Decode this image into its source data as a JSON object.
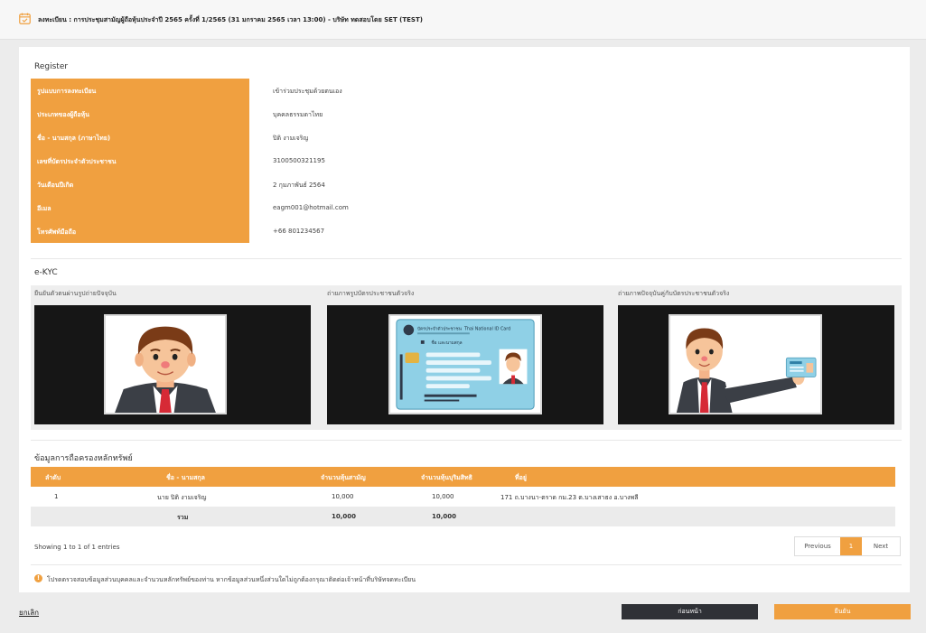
{
  "header": {
    "title": "ลงทะเบียน : การประชุมสามัญผู้ถือหุ้นประจำปี 2565 ครั้งที่ 1/2565 (31 มกราคม 2565 เวลา 13:00) - บริษัท ทดสอบโดย SET (TEST)",
    "icon": "calendar-icon"
  },
  "register": {
    "section_title": "Register",
    "rows": [
      {
        "label": "รูปแบบการลงทะเบียน",
        "value": "เข้าร่วมประชุมด้วยตนเอง"
      },
      {
        "label": "ประเภทของผู้ถือหุ้น",
        "value": "บุคคลธรรมดาไทย"
      },
      {
        "label": "ชื่อ - นามสกุล (ภาษาไทย)",
        "value": "ปิติ งามเจริญ"
      },
      {
        "label": "เลขที่บัตรประจำตัวประชาชน",
        "value": "3100500321195"
      },
      {
        "label": "วันเดือนปีเกิด",
        "value": "2 กุมภาพันธ์ 2564"
      },
      {
        "label": "อีเมล",
        "value": "eagm001@hotmail.com"
      },
      {
        "label": "โทรศัพท์มือถือ",
        "value": "+66 801234567"
      }
    ]
  },
  "ekyc": {
    "section_title": "e-KYC",
    "panels": [
      {
        "caption": "ยืนยันตัวตนผ่านรูปถ่ายปัจจุบัน"
      },
      {
        "caption": "ถ่ายภาพรูปบัตรประชาชนตัวจริง",
        "card_title_th": "บัตรประจำตัวประชาชน",
        "card_title_en": "Thai National ID Card",
        "card_name": "ชื่อ และนามสกุล"
      },
      {
        "caption": "ถ่ายภาพปัจจุบันคู่กับบัตรประชาชนตัวจริง"
      }
    ]
  },
  "holdings": {
    "section_title": "ข้อมูลการถือครองหลักทรัพย์",
    "columns": [
      "ลำดับ",
      "ชื่อ - นามสกุล",
      "จำนวนหุ้นสามัญ",
      "จำนวนหุ้นบุริมสิทธิ",
      "ที่อยู่"
    ],
    "rows": [
      {
        "no": "1",
        "name": "นาย ปิติ งามเจริญ",
        "common": "10,000",
        "preferred": "10,000",
        "address": "171 ถ.บางนา-ตราด กม.23 ต.บางเสาธง อ.บางพลี"
      }
    ],
    "total": {
      "label": "รวม",
      "common": "10,000",
      "preferred": "10,000"
    },
    "showing": "Showing 1 to 1 of 1 entries",
    "pager": {
      "previous": "Previous",
      "current": "1",
      "next": "Next"
    }
  },
  "notice": "โปรดตรวจสอบข้อมูลส่วนบุคคลและจำนวนหลักทรัพย์ของท่าน หากข้อมูลส่วนหนึ่งส่วนใดไม่ถูกต้องกรุณาติดต่อเจ้าหน้าที่บริษัทจดทะเบียน",
  "footer": {
    "cancel": "ยกเลิก",
    "back": "ก่อนหน้า",
    "confirm": "ยืนยัน"
  },
  "colors": {
    "accent": "#f0a040",
    "dark_button": "#2f3136"
  }
}
